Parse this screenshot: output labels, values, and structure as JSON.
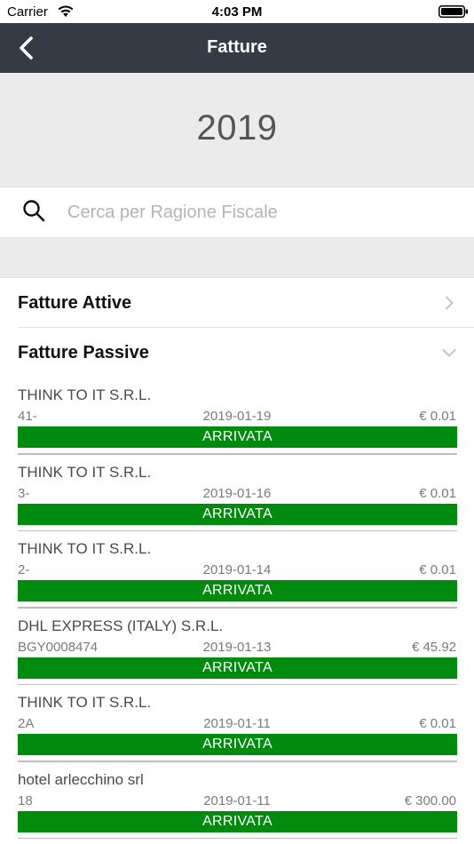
{
  "status_bar": {
    "carrier": "Carrier",
    "time": "4:03 PM"
  },
  "nav": {
    "title": "Fatture",
    "back_icon": "chevron-left-icon"
  },
  "year": "2019",
  "search": {
    "placeholder": "Cerca per Ragione Fiscale",
    "value": "",
    "icon": "search-icon"
  },
  "sections": {
    "attive": {
      "label": "Fatture Attive",
      "state": "collapsed"
    },
    "passive": {
      "label": "Fatture Passive",
      "state": "expanded"
    }
  },
  "colors": {
    "nav_bg": "#343b45",
    "status_green": "#008a0e",
    "header_bg": "#ebebeb"
  },
  "invoices": [
    {
      "name": "THINK TO IT S.R.L.",
      "number": "41-",
      "date": "2019-01-19",
      "amount": "€ 0.01",
      "status": "ARRIVATA"
    },
    {
      "name": "THINK TO IT S.R.L.",
      "number": "3-",
      "date": "2019-01-16",
      "amount": "€ 0.01",
      "status": "ARRIVATA"
    },
    {
      "name": "THINK TO IT S.R.L.",
      "number": "2-",
      "date": "2019-01-14",
      "amount": "€ 0.01",
      "status": "ARRIVATA"
    },
    {
      "name": "DHL EXPRESS (ITALY) S.R.L.",
      "number": "BGY0008474",
      "date": "2019-01-13",
      "amount": "€ 45.92",
      "status": "ARRIVATA"
    },
    {
      "name": "THINK TO IT S.R.L.",
      "number": "2A",
      "date": "2019-01-11",
      "amount": "€ 0.01",
      "status": "ARRIVATA"
    },
    {
      "name": "hotel arlecchino srl",
      "number": "18",
      "date": "2019-01-11",
      "amount": "€ 300.00",
      "status": "ARRIVATA"
    }
  ]
}
